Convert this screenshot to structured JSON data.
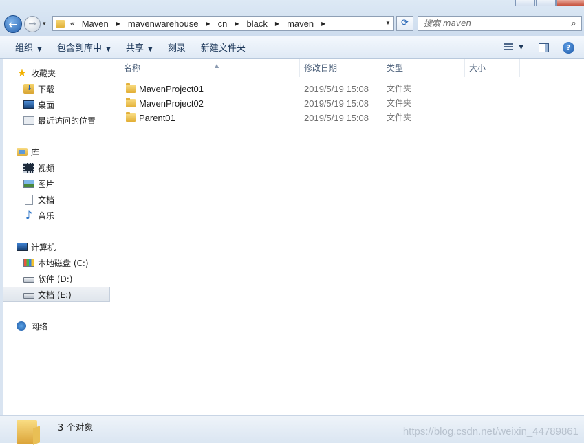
{
  "address": {
    "overflow": "«",
    "crumbs": [
      "Maven",
      "mavenwarehouse",
      "cn",
      "black",
      "maven"
    ]
  },
  "search": {
    "placeholder": "搜索 maven"
  },
  "toolbar": {
    "organize": "组织",
    "include_in_library": "包含到库中",
    "share": "共享",
    "burn": "刻录",
    "new_folder": "新建文件夹"
  },
  "sidebar": {
    "favorites": {
      "label": "收藏夹",
      "items": [
        "下载",
        "桌面",
        "最近访问的位置"
      ]
    },
    "libraries": {
      "label": "库",
      "items": [
        "视频",
        "图片",
        "文档",
        "音乐"
      ]
    },
    "computer": {
      "label": "计算机",
      "items": [
        "本地磁盘 (C:)",
        "软件 (D:)",
        "文档 (E:)"
      ]
    },
    "network": {
      "label": "网络"
    }
  },
  "columns": {
    "name": "名称",
    "date": "修改日期",
    "type": "类型",
    "size": "大小"
  },
  "files": [
    {
      "name": "MavenProject01",
      "date": "2019/5/19 15:08",
      "type": "文件夹"
    },
    {
      "name": "MavenProject02",
      "date": "2019/5/19 15:08",
      "type": "文件夹"
    },
    {
      "name": "Parent01",
      "date": "2019/5/19 15:08",
      "type": "文件夹"
    }
  ],
  "status": {
    "count": "3 个对象"
  },
  "watermark": "https://blog.csdn.net/weixin_44789861",
  "icons": {
    "back": "←",
    "forward": "→",
    "history": "▾",
    "refresh": "⟳",
    "search": "⌕",
    "help": "?"
  }
}
